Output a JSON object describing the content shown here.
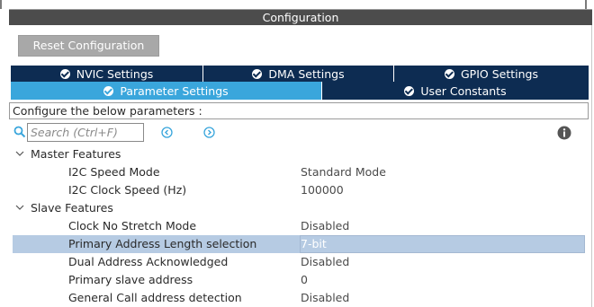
{
  "window": {
    "title": "Configuration"
  },
  "toolbar": {
    "reset_label": "Reset Configuration"
  },
  "tabs": {
    "row1": [
      {
        "label": "NVIC Settings"
      },
      {
        "label": "DMA Settings"
      },
      {
        "label": "GPIO Settings"
      }
    ],
    "row2": [
      {
        "label": "Parameter Settings",
        "active": true
      },
      {
        "label": "User Constants"
      }
    ]
  },
  "info_text": "Configure the below parameters :",
  "search": {
    "placeholder": "Search (Ctrl+F)",
    "value": ""
  },
  "groups": [
    {
      "label": "Master Features",
      "params": [
        {
          "label": "I2C Speed Mode",
          "value": "Standard Mode"
        },
        {
          "label": "I2C Clock Speed (Hz)",
          "value": "100000"
        }
      ]
    },
    {
      "label": "Slave Features",
      "params": [
        {
          "label": "Clock No Stretch Mode",
          "value": "Disabled"
        },
        {
          "label": "Primary Address Length selection",
          "value": "7-bit",
          "selected": true
        },
        {
          "label": "Dual Address Acknowledged",
          "value": "Disabled"
        },
        {
          "label": "Primary slave address",
          "value": "0"
        },
        {
          "label": "General Call address detection",
          "value": "Disabled"
        }
      ]
    }
  ],
  "colors": {
    "tab_dark": "#0d2c52",
    "tab_active": "#3aa6dc",
    "selected_row": "#b6cbe3",
    "title_bar": "#4c4c4c",
    "icon_accent": "#3aa6dc"
  },
  "icons": [
    "check-circle-icon",
    "search-icon",
    "previous-icon",
    "next-icon",
    "info-icon",
    "chevron-down-icon"
  ]
}
